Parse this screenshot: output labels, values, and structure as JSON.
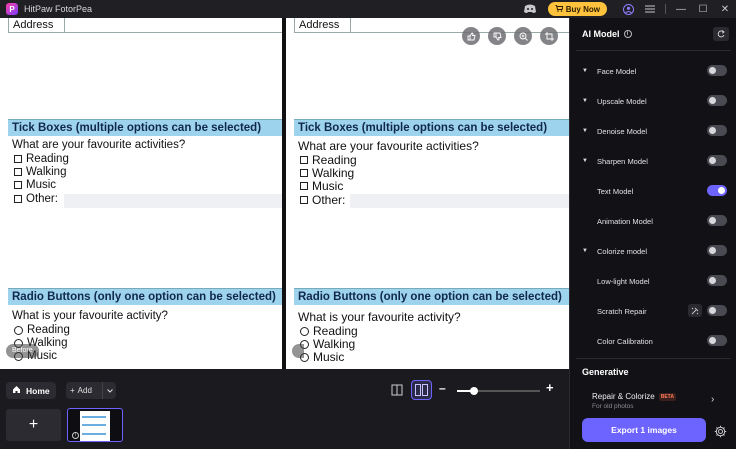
{
  "titlebar": {
    "logo_letter": "P",
    "app_title": "HitPaw FotorPea",
    "buy_now": "Buy Now",
    "minimize": "—",
    "maximize": "☐",
    "close": "✕"
  },
  "document": {
    "address_label": "Address",
    "tick_section": "Tick Boxes (multiple options can be selected)",
    "tick_question": "What are your favourite activities?",
    "tick_options": [
      "Reading",
      "Walking",
      "Music",
      "Other:"
    ],
    "radio_section": "Radio Buttons (only one option can be selected)",
    "radio_question": "What is your favourite activity?",
    "radio_options": [
      "Reading",
      "Walking",
      "Music"
    ]
  },
  "compare": {
    "before_label": "Before"
  },
  "bottom": {
    "home_label": "Home",
    "add_label": "Add",
    "zoom_level": 0.2,
    "add_tile": "+"
  },
  "panel": {
    "title": "AI Model",
    "models": [
      {
        "label": "Face Model",
        "on": false
      },
      {
        "label": "Upscale Model",
        "on": false
      },
      {
        "label": "Denoise Model",
        "on": false
      },
      {
        "label": "Sharpen Model",
        "on": false
      },
      {
        "label": "Text Model",
        "on": true
      },
      {
        "label": "Animation Model",
        "on": false
      },
      {
        "label": "Colorize model",
        "on": false
      },
      {
        "label": "Low-light Model",
        "on": false
      },
      {
        "label": "Scratch Repair",
        "on": false
      },
      {
        "label": "Color Calibration",
        "on": false
      }
    ],
    "generative_title": "Generative",
    "generative_item": "Repair & Colorize",
    "beta_badge": "BETA",
    "generative_sub": "For old photos",
    "export_label": "Export 1 images"
  },
  "colors": {
    "accent": "#6d63ff",
    "buy": "#ffc23d",
    "section_bg": "#9ed3ee"
  }
}
